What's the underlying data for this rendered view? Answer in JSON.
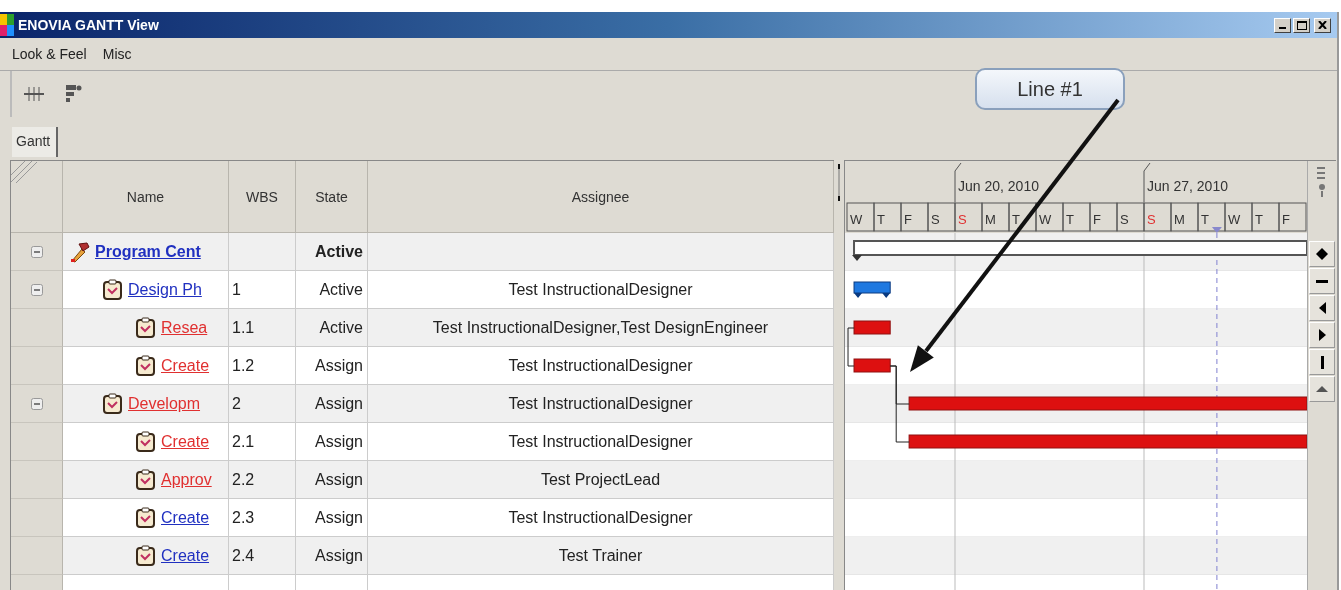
{
  "window": {
    "title": "ENOVIA GANTT View"
  },
  "menu": [
    "Look & Feel",
    "Misc"
  ],
  "tabs": [
    {
      "label": "Gantt",
      "selected": true
    }
  ],
  "table": {
    "columns": [
      "Name",
      "WBS",
      "State",
      "Assignee"
    ],
    "rows": [
      {
        "name": "Program Cent",
        "kind": "program",
        "late": false,
        "wbs": "",
        "state": "Active",
        "assignee": "",
        "expanded": true,
        "bar": {
          "kind": "summary"
        },
        "children": [
          {
            "name": "Design Ph",
            "kind": "task",
            "late": false,
            "wbs": "1",
            "state": "Active",
            "assignee": "Test InstructionalDesigner",
            "expanded": true,
            "bar": {
              "kind": "phase"
            },
            "children": [
              {
                "name": "Resea",
                "kind": "task",
                "late": true,
                "wbs": "1.1",
                "state": "Active",
                "assignee": "Test InstructionalDesigner,Test DesignEngineer",
                "bar": {
                  "kind": "task"
                }
              },
              {
                "name": "Create",
                "kind": "task",
                "late": true,
                "wbs": "1.2",
                "state": "Assign",
                "assignee": "Test InstructionalDesigner",
                "bar": {
                  "kind": "task",
                  "link": {
                    "kind": "start_start"
                  }
                }
              }
            ]
          },
          {
            "name": "Developm",
            "kind": "task",
            "late": true,
            "wbs": "2",
            "state": "Assign",
            "assignee": "Test InstructionalDesigner",
            "expanded": true,
            "bar": {
              "kind": "task",
              "link": {
                "kind": "finish_start"
              }
            },
            "children": [
              {
                "name": "Create",
                "kind": "task",
                "late": true,
                "wbs": "2.1",
                "state": "Assign",
                "assignee": "Test InstructionalDesigner",
                "bar": {
                  "kind": "task",
                  "link": {
                    "kind": "finish_start"
                  }
                }
              },
              {
                "name": "Approv",
                "kind": "task",
                "late": true,
                "wbs": "2.2",
                "state": "Assign",
                "assignee": "Test ProjectLead"
              },
              {
                "name": "Create",
                "kind": "task",
                "late": false,
                "wbs": "2.3",
                "state": "Assign",
                "assignee": "Test InstructionalDesigner"
              },
              {
                "name": "Create",
                "kind": "task",
                "late": false,
                "wbs": "2.4",
                "state": "Assign",
                "assignee": "Test Trainer"
              }
            ]
          }
        ]
      }
    ]
  },
  "gantt": {
    "days": [
      {
        "label": "W",
        "weekend": false
      },
      {
        "label": "T",
        "weekend": false
      },
      {
        "label": "F",
        "weekend": false
      },
      {
        "label": "S",
        "weekend": false
      },
      {
        "label": "S",
        "weekend": true,
        "week": "Jun 20, 2010"
      },
      {
        "label": "M",
        "weekend": false
      },
      {
        "label": "T",
        "weekend": false
      },
      {
        "label": "W",
        "weekend": false
      },
      {
        "label": "T",
        "weekend": false
      },
      {
        "label": "F",
        "weekend": false
      },
      {
        "label": "S",
        "weekend": false
      },
      {
        "label": "S",
        "weekend": true,
        "week": "Jun 27, 2010"
      },
      {
        "label": "M",
        "weekend": false
      },
      {
        "label": "T",
        "weekend": false,
        "today": true
      },
      {
        "label": "W",
        "weekend": false
      },
      {
        "label": "T",
        "weekend": false
      },
      {
        "label": "F",
        "weekend": false
      }
    ]
  },
  "callout": {
    "text": "Line #1"
  }
}
